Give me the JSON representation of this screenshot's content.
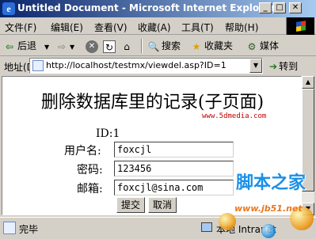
{
  "window": {
    "title": "Untitled Document - Microsoft Internet Explorer",
    "app_icon_glyph": "e"
  },
  "menubar": {
    "items": [
      "文件(F)",
      "编辑(E)",
      "查看(V)",
      "收藏(A)",
      "工具(T)",
      "帮助(H)"
    ]
  },
  "toolbar": {
    "back_label": "后退",
    "search_label": "搜索",
    "favorites_label": "收藏夹",
    "media_label": "媒体"
  },
  "address": {
    "label": "地址(D)",
    "url": "http://localhost/testmx/viewdel.asp?ID=1",
    "go_label": "转到"
  },
  "page": {
    "title": "删除数据库里的记录(子页面)",
    "site_mark": "www.5dmedia.com",
    "id_label": "ID:1",
    "username_label": "用户名:",
    "username_value": "foxcjl",
    "password_label": "密码:",
    "password_value": "123456",
    "email_label": "邮箱:",
    "email_value": "foxcjl@sina.com",
    "submit_label": "提交",
    "cancel_label": "取消"
  },
  "status": {
    "text": "完毕",
    "zone": "本地 Intranet"
  },
  "watermark": {
    "cn": "脚本之家",
    "en": "www.jb51.net"
  }
}
